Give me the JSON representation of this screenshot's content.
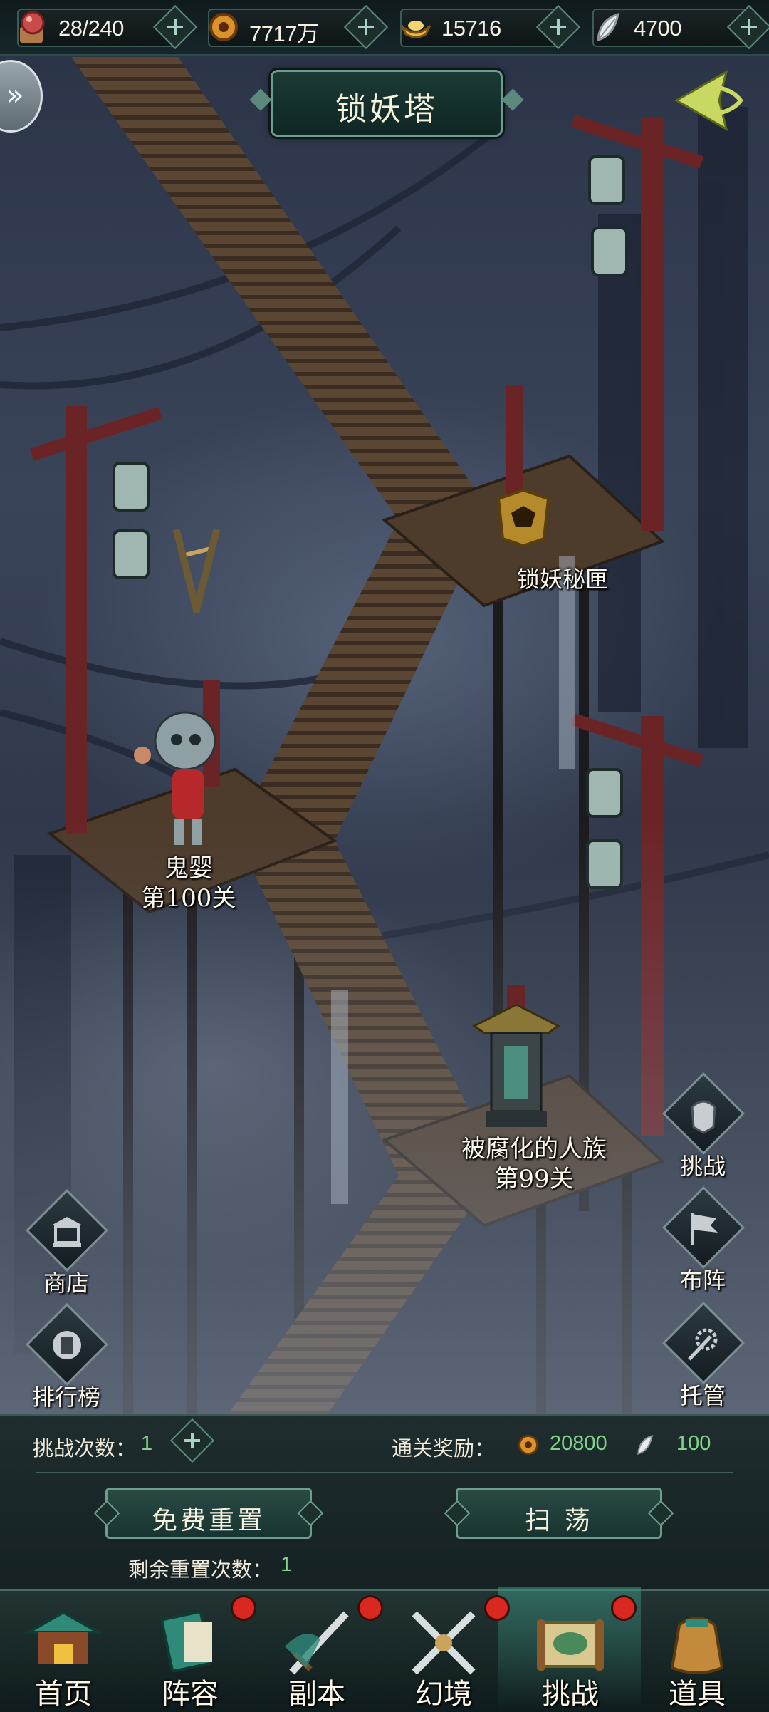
{
  "resources": [
    {
      "icon": "stamina-orb-icon",
      "value": "28/240"
    },
    {
      "icon": "copper-coin-icon",
      "value": "7717万"
    },
    {
      "icon": "gold-ingot-icon",
      "value": "15716"
    },
    {
      "icon": "jade-feather-icon",
      "value": "4700"
    }
  ],
  "header": {
    "title": "锁妖塔"
  },
  "map": {
    "chest": {
      "name": "锁妖秘匣"
    },
    "stage_current": {
      "name": "鬼婴",
      "level": "第100关"
    },
    "stage_previous": {
      "name": "被腐化的人族",
      "level": "第99关"
    }
  },
  "side_right": [
    {
      "icon": "shield-helmet-icon",
      "label": "挑战"
    },
    {
      "icon": "flag-icon",
      "label": "布阵"
    },
    {
      "icon": "gear-sword-icon",
      "label": "托管"
    }
  ],
  "side_left": [
    {
      "icon": "shop-stall-icon",
      "label": "商店"
    },
    {
      "icon": "ranking-plaque-icon",
      "label": "排行榜"
    }
  ],
  "panel": {
    "challenge_label": "挑战次数：",
    "challenge_count": "1",
    "reward_label": "通关奖励：",
    "reward_coin": "20800",
    "reward_feather": "100",
    "free_reset": "免费重置",
    "sweep": "扫 荡",
    "remaining_label": "剩余重置次数：",
    "remaining_count": "1"
  },
  "nav": [
    {
      "label": "首页",
      "badge": false,
      "active": false
    },
    {
      "label": "阵容",
      "badge": true,
      "active": false
    },
    {
      "label": "副本",
      "badge": true,
      "active": false
    },
    {
      "label": "幻境",
      "badge": true,
      "active": false
    },
    {
      "label": "挑战",
      "badge": true,
      "active": true
    },
    {
      "label": "道具",
      "badge": false,
      "active": false
    }
  ],
  "colors": {
    "accent": "#6e9c8e",
    "badge": "#d8281f",
    "value_green": "#7fd489"
  }
}
